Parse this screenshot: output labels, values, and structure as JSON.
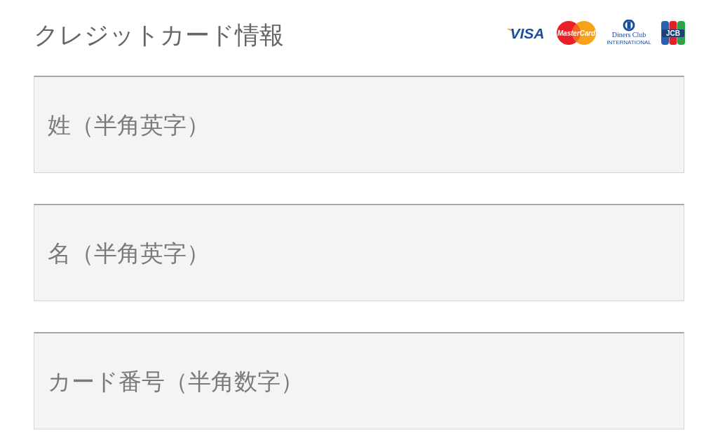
{
  "title": "クレジットカード情報",
  "card_logos": [
    {
      "kind": "visa",
      "text": "VISA"
    },
    {
      "kind": "mastercard",
      "text": "MasterCard"
    },
    {
      "kind": "diners",
      "text": "Diners Club",
      "subtext": "INTERNATIONAL"
    },
    {
      "kind": "jcb",
      "text": "JCB"
    }
  ],
  "fields": [
    {
      "placeholder": "姓（半角英字）"
    },
    {
      "placeholder": "名（半角英字）"
    },
    {
      "placeholder": "カード番号（半角数字）"
    }
  ]
}
